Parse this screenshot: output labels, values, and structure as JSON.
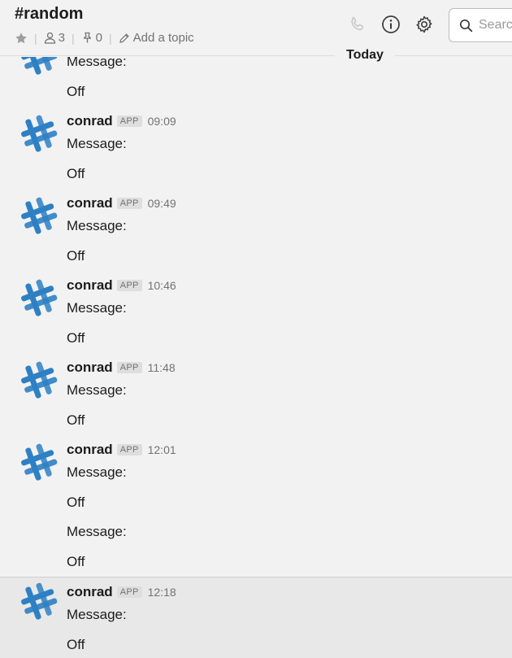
{
  "header": {
    "channel": "#random",
    "members": "3",
    "pins": "0",
    "topic": "Add a topic",
    "search_placeholder": "Search"
  },
  "divider": {
    "label": "Today"
  },
  "messages": [
    {
      "lines": [
        "Message:",
        "Off"
      ]
    },
    {
      "author": "conrad",
      "badge": "APP",
      "time": "09:09",
      "lines": [
        "Message:",
        "Off"
      ]
    },
    {
      "author": "conrad",
      "badge": "APP",
      "time": "09:49",
      "lines": [
        "Message:",
        "Off"
      ]
    },
    {
      "author": "conrad",
      "badge": "APP",
      "time": "10:46",
      "lines": [
        "Message:",
        "Off"
      ]
    },
    {
      "author": "conrad",
      "badge": "APP",
      "time": "11:48",
      "lines": [
        "Message:",
        "Off"
      ]
    },
    {
      "author": "conrad",
      "badge": "APP",
      "time": "12:01",
      "lines": [
        "Message:",
        "Off",
        "Message:",
        "Off"
      ]
    },
    {
      "author": "conrad",
      "badge": "APP",
      "time": "12:18",
      "lines": [
        "Message:",
        "Off"
      ]
    }
  ],
  "colors": {
    "avatar_blue": "#2e80c4",
    "background": "#f2f2f2",
    "highlight": "#e8e8e8"
  }
}
